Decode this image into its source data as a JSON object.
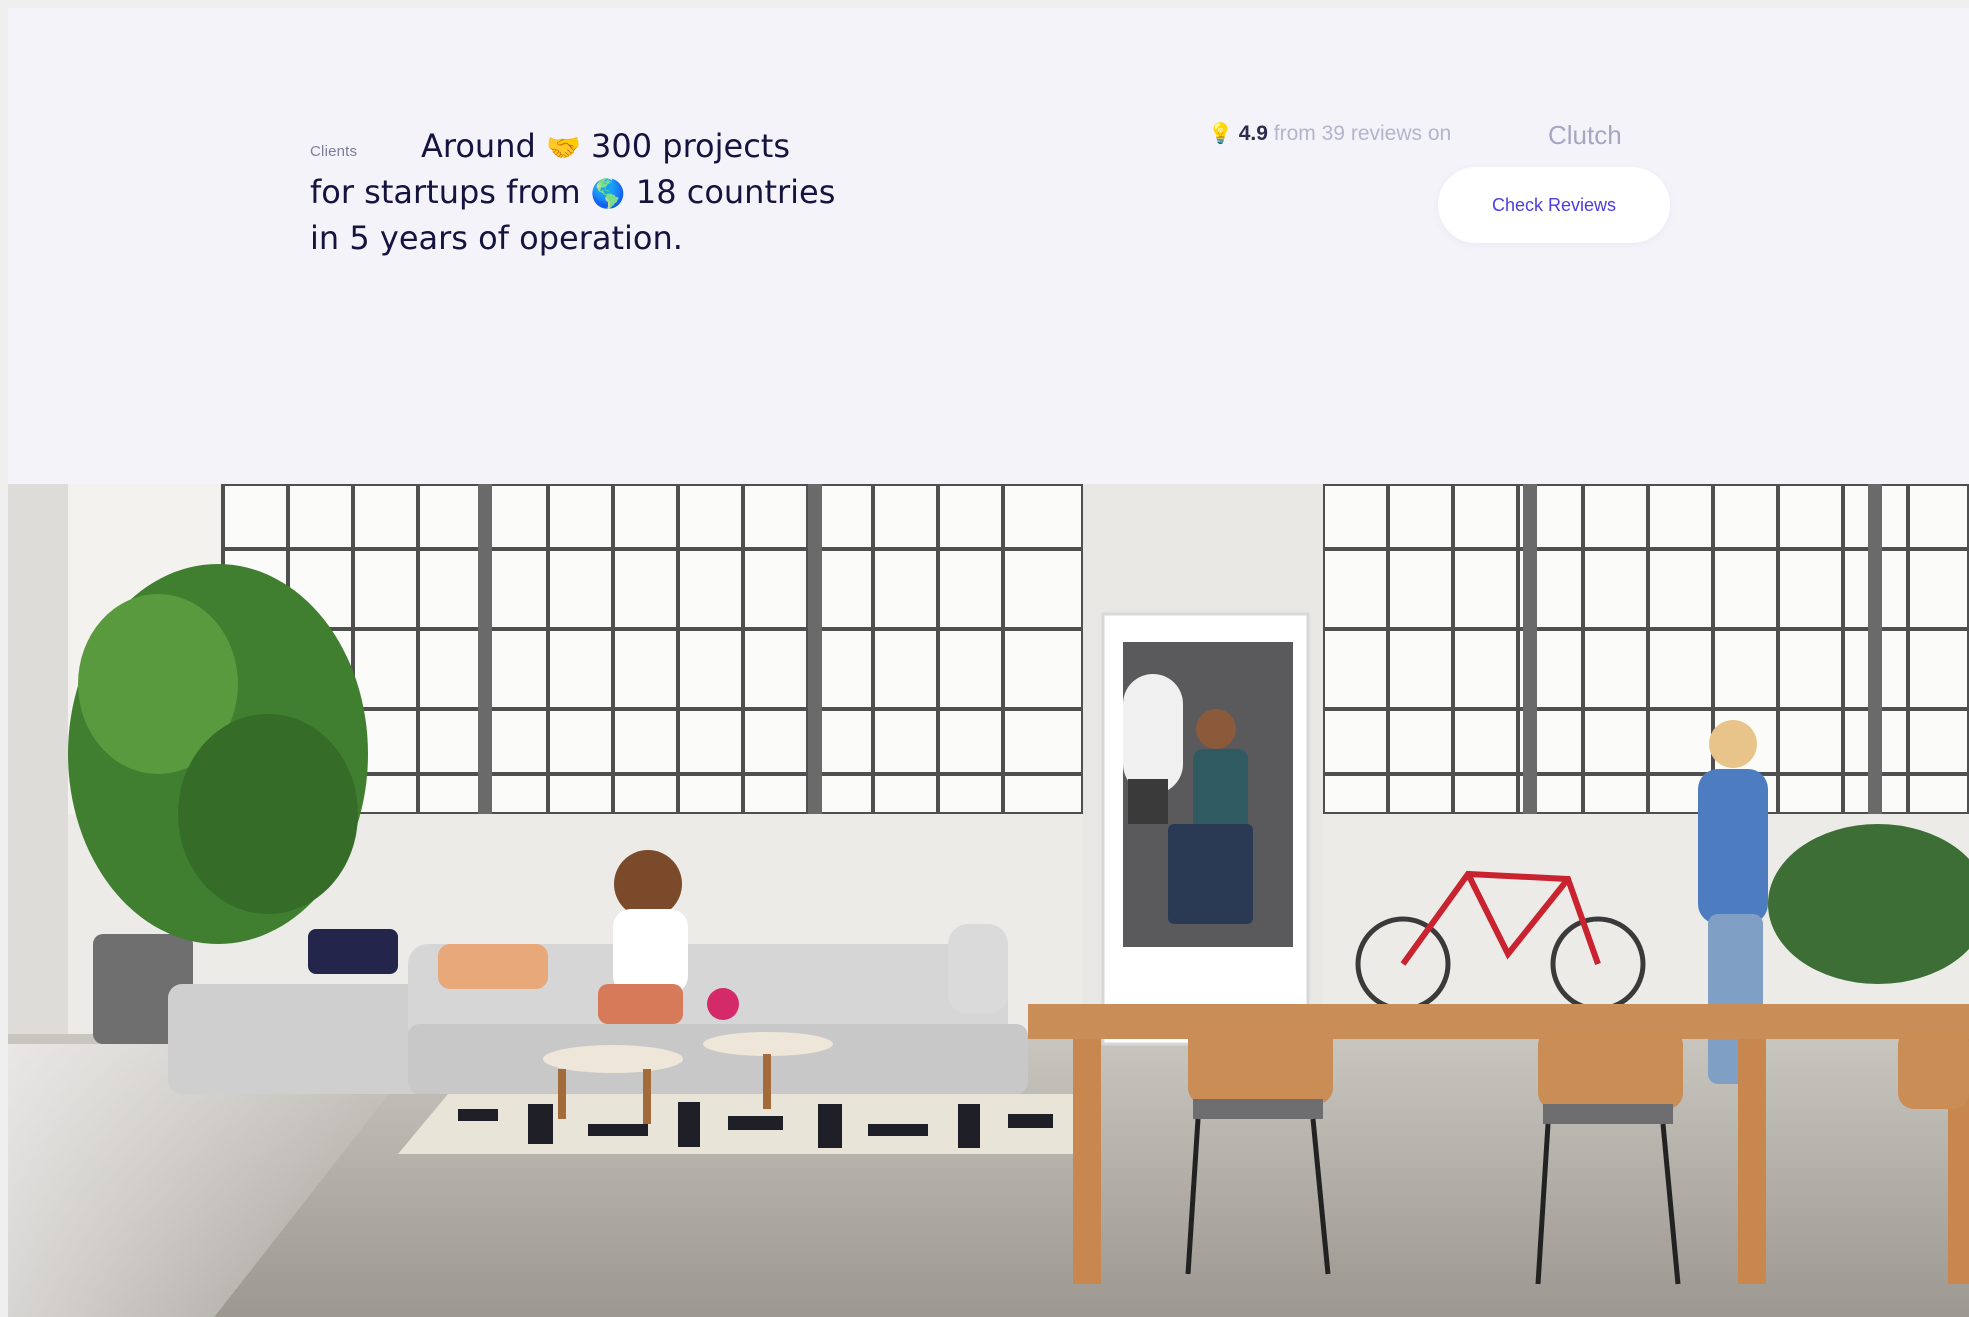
{
  "clients": {
    "label": "Clients",
    "headline_line1": "Around",
    "headline_line1_icon": "🤝",
    "headline_line1_rest": "300 projects",
    "headline_line2": "for startups from",
    "headline_line2_icon": "🌎",
    "headline_line2_rest": "18 countries",
    "headline_line3": "in 5 years of operation."
  },
  "reviews": {
    "icon": "lightbulb-icon",
    "icon_glyph": "💡",
    "score": "4.9",
    "text": "from 39 reviews on",
    "platform": "Clutch",
    "button_label": "Check Reviews"
  },
  "colors": {
    "background": "#f4f3fa",
    "headline": "#14143f",
    "accent": "#4c3dde"
  }
}
